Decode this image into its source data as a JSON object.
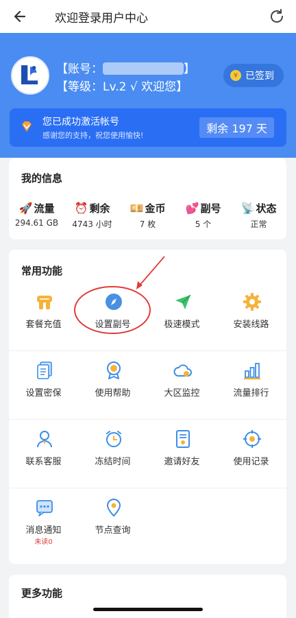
{
  "header": {
    "title": "欢迎登录用户中心",
    "back_icon": "back-arrow-icon",
    "refresh_icon": "refresh-icon"
  },
  "profile": {
    "account_prefix": "【账号：",
    "account_suffix": "】",
    "level_text": "【等级：Lv.2 √ 欢迎您】",
    "signed_label": "已签到"
  },
  "activation": {
    "title": "您已成功激活帐号",
    "subtitle": "感谢您的支持，祝您使用愉快!",
    "remaining": "剩余 197 天"
  },
  "my_info": {
    "title": "我的信息",
    "items": [
      {
        "icon": "rocket-icon",
        "label": "流量",
        "value": "294.61 GB"
      },
      {
        "icon": "alarm-clock-icon",
        "label": "剩余",
        "value": "4743 小时"
      },
      {
        "icon": "gold-coin-icon",
        "label": "金币",
        "value": "7 枚"
      },
      {
        "icon": "hearts-icon",
        "label": "副号",
        "value": "5 个"
      },
      {
        "icon": "satellite-icon",
        "label": "状态",
        "value": "正常"
      }
    ]
  },
  "common_functions": {
    "title": "常用功能",
    "rows": [
      [
        {
          "icon": "package-recharge-icon",
          "label": "套餐充值"
        },
        {
          "icon": "compass-icon",
          "label": "设置副号"
        },
        {
          "icon": "paper-plane-icon",
          "label": "极速模式"
        },
        {
          "icon": "gear-icon",
          "label": "安装线路"
        }
      ],
      [
        {
          "icon": "documents-icon",
          "label": "设置密保"
        },
        {
          "icon": "medal-icon",
          "label": "使用帮助"
        },
        {
          "icon": "cloud-icon",
          "label": "大区监控"
        },
        {
          "icon": "bar-chart-icon",
          "label": "流量排行"
        }
      ],
      [
        {
          "icon": "user-service-icon",
          "label": "联系客服"
        },
        {
          "icon": "alarm-icon",
          "label": "冻结时间"
        },
        {
          "icon": "invite-doc-icon",
          "label": "邀请好友"
        },
        {
          "icon": "target-icon",
          "label": "使用记录"
        }
      ],
      [
        {
          "icon": "message-icon",
          "label": "消息通知",
          "sub": "未读0"
        },
        {
          "icon": "location-shield-icon",
          "label": "节点查询"
        }
      ]
    ]
  },
  "more_functions": {
    "title": "更多功能"
  },
  "colors": {
    "primary_blue": "#4a8cf1",
    "activation_blue": "#2a6ef3",
    "icon_blue": "#3a8ee6",
    "icon_orange": "#f5b23a",
    "icon_green": "#3cc36a",
    "annotation_red": "#e03a3a"
  }
}
